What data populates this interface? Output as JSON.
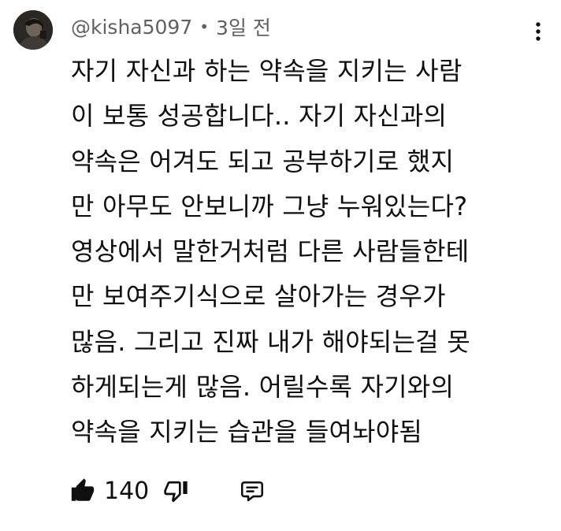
{
  "comment": {
    "author": "@kisha5097",
    "separator": "•",
    "timestamp": "3일 전",
    "lines": [
      "자기 자신과 하는 약속을 지키는 사람",
      "이 보통 성공합니다.. 자기 자신과의",
      "약속은 어겨도 되고 공부하기로 했지",
      "만 아무도 안보니까 그냥 누워있는다?",
      "영상에서 말한거처럼 다른 사람들한테",
      "만 보여주기식으로 살아가는 경우가",
      "많음. 그리고 진짜 내가 해야되는걸 못",
      "하게되는게 많음. 어릴수록 자기와의",
      "약속을 지키는 습관을 들여놔야됨"
    ],
    "like_count": "140"
  },
  "icons": {
    "avatar": "avatar-image",
    "more": "kebab-menu-icon",
    "like": "thumbs-up-filled-icon",
    "dislike": "thumbs-down-outline-icon",
    "reply": "reply-comment-icon"
  },
  "colors": {
    "text": "#0f0f0f",
    "meta": "#606060",
    "avatar_bg": "#2a2622"
  }
}
